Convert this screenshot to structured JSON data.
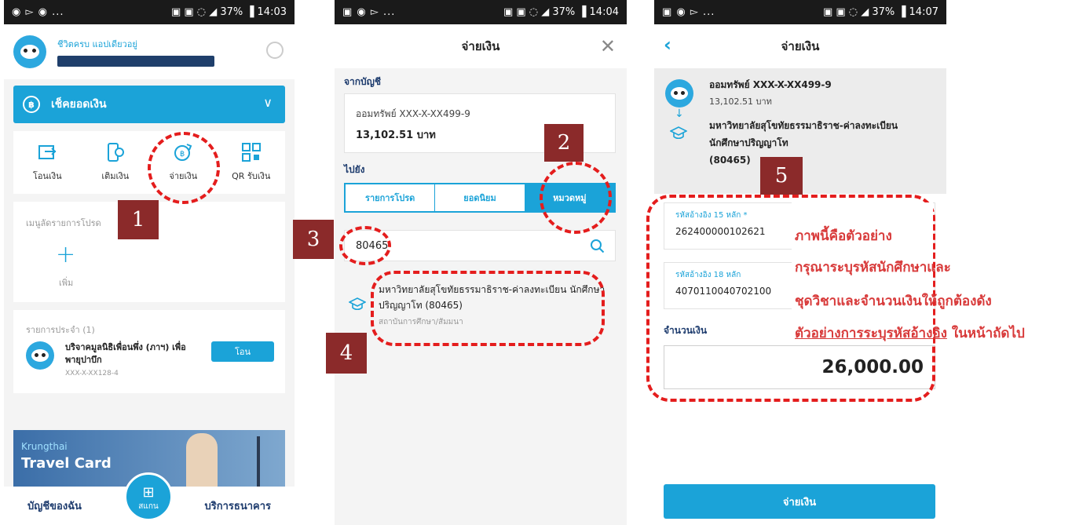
{
  "status_bars": {
    "p1": {
      "icons": "◉ ▻ ◉ ...",
      "right": "▣ ▣ ◌ ◢ 37% ▐ 14:03"
    },
    "p2": {
      "icons": "▣ ◉ ▻ ...",
      "right": "▣ ▣ ◌ ◢ 37% ▐ 14:04"
    },
    "p3": {
      "icons": "▣ ◉ ▻ ...",
      "right": "▣ ▣ ◌ ◢ 37% ▐ 14:07"
    }
  },
  "screen1": {
    "greeting": "ชีวิตครบ แอปเดียวอยู่",
    "check_balance": "เช็คยอดเงิน",
    "menu": [
      {
        "label": "โอนเงิน",
        "icon": "transfer-icon"
      },
      {
        "label": "เติมเงิน",
        "icon": "topup-icon"
      },
      {
        "label": "จ่ายเงิน",
        "icon": "pay-bill-icon"
      },
      {
        "label": "QR รับเงิน",
        "icon": "qr-icon"
      }
    ],
    "favorites_title": "เมนูลัดรายการโปรด",
    "add_label": "เพิ่ม",
    "recurring_title": "รายการประจำ (1)",
    "recurring_item_name": "บริจาคมูลนิธิเพื่อนพึ่ง (ภาฯ) เพื่อพายุปาบึก",
    "recurring_item_account": "XXX-X-XX128-4",
    "transfer_button": "โอน",
    "banner_brand": "Krungthai",
    "banner_title": "Travel Card",
    "nav_left": "บัญชีของฉัน",
    "nav_center": "สแกน",
    "nav_right": "บริการธนาคาร"
  },
  "screen2": {
    "title": "จ่ายเงิน",
    "from_label": "จากบัญชี",
    "account_name": "ออมทรัพย์ XXX-X-XX499-9",
    "account_balance": "13,102.51 บาท",
    "to_label": "ไปยัง",
    "tabs": [
      "รายการโปรด",
      "ยอดนิยม",
      "หมวดหมู่"
    ],
    "search_value": "80465",
    "result_title": "มหาวิทยาลัยสุโขทัยธรรมาธิราช-ค่าลงทะเบียน นักศึกษาปริญญาโท (80465)",
    "result_category": "สถาบันการศึกษา/สัมมนา"
  },
  "screen3": {
    "title": "จ่ายเงิน",
    "account_name": "ออมทรัพย์ XXX-X-XX499-9",
    "account_balance": "13,102.51 บาท",
    "biller_line1": "มหาวิทยาลัยสุโขทัยธรรมาธิราช-ค่าลงทะเบียน",
    "biller_line2": "นักศึกษาปริญญาโท",
    "biller_code": "(80465)",
    "ref1_label": "รหัสอ้างอิง 15 หลัก *",
    "ref1_value": "262400000102621",
    "ref2_label": "รหัสอ้างอิง 18 หลัก",
    "ref2_value": "4070110040702100",
    "amount_label": "จำนวนเงิน",
    "amount_value": "26,000.00",
    "pay_button": "จ่ายเงิน"
  },
  "annotations": {
    "step1": "1",
    "step2": "2",
    "step3": "3",
    "step4": "4",
    "step5": "5",
    "note1": "ภาพนี้คือตัวอย่าง",
    "note2": "กรุณาระบุรหัสนักศึกษาและ",
    "note3": "ชุดวิชาและจำนวนเงินให้ถูกต้องดัง",
    "note4_underlined": "ตัวอย่างการระบุรหัสอ้างอิง",
    "note4_rest": " ในหน้าถัดไป",
    "accent_red": "#e41d1d",
    "badge_color": "#8b2a2a",
    "brand_blue": "#1ba3d8"
  }
}
